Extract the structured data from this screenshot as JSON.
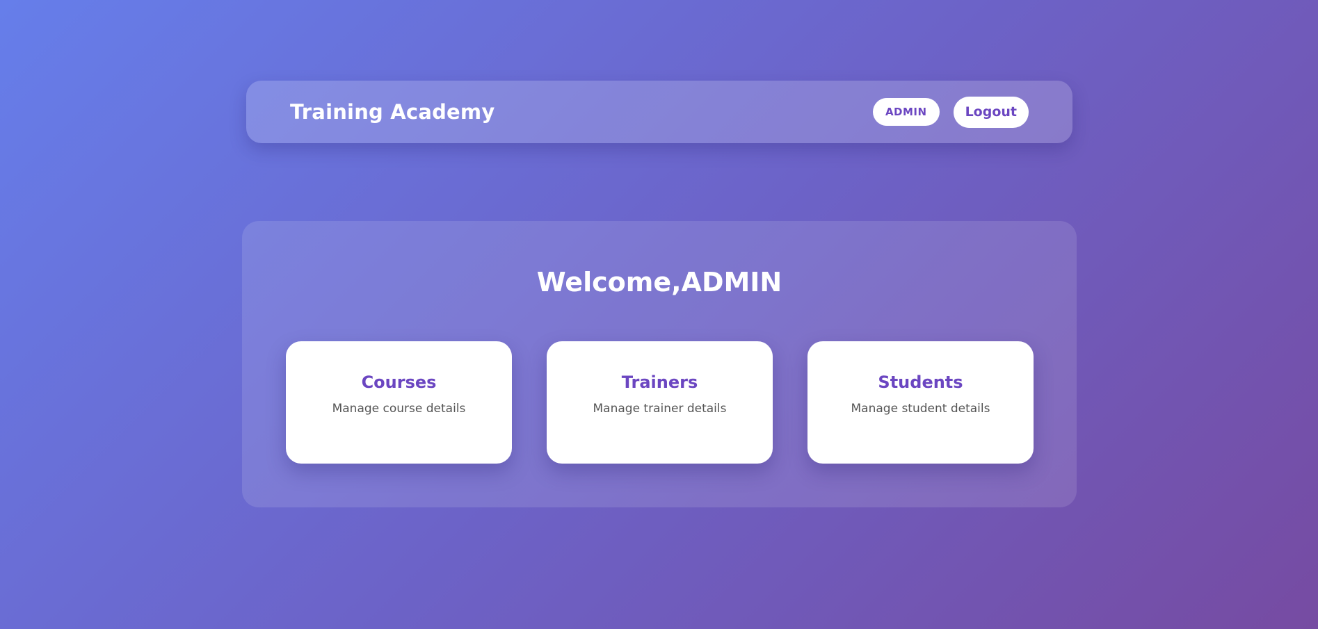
{
  "navbar": {
    "brand": "Training Academy",
    "role_badge": "ADMIN",
    "logout_label": "Logout"
  },
  "main": {
    "welcome": "Welcome,ADMIN",
    "cards": [
      {
        "title": "Courses",
        "description": "Manage course details"
      },
      {
        "title": "Trainers",
        "description": "Manage trainer details"
      },
      {
        "title": "Students",
        "description": "Manage student details"
      }
    ]
  },
  "colors": {
    "accent": "#6b46c1",
    "gradient_start": "#667eea",
    "gradient_end": "#764ba2"
  }
}
